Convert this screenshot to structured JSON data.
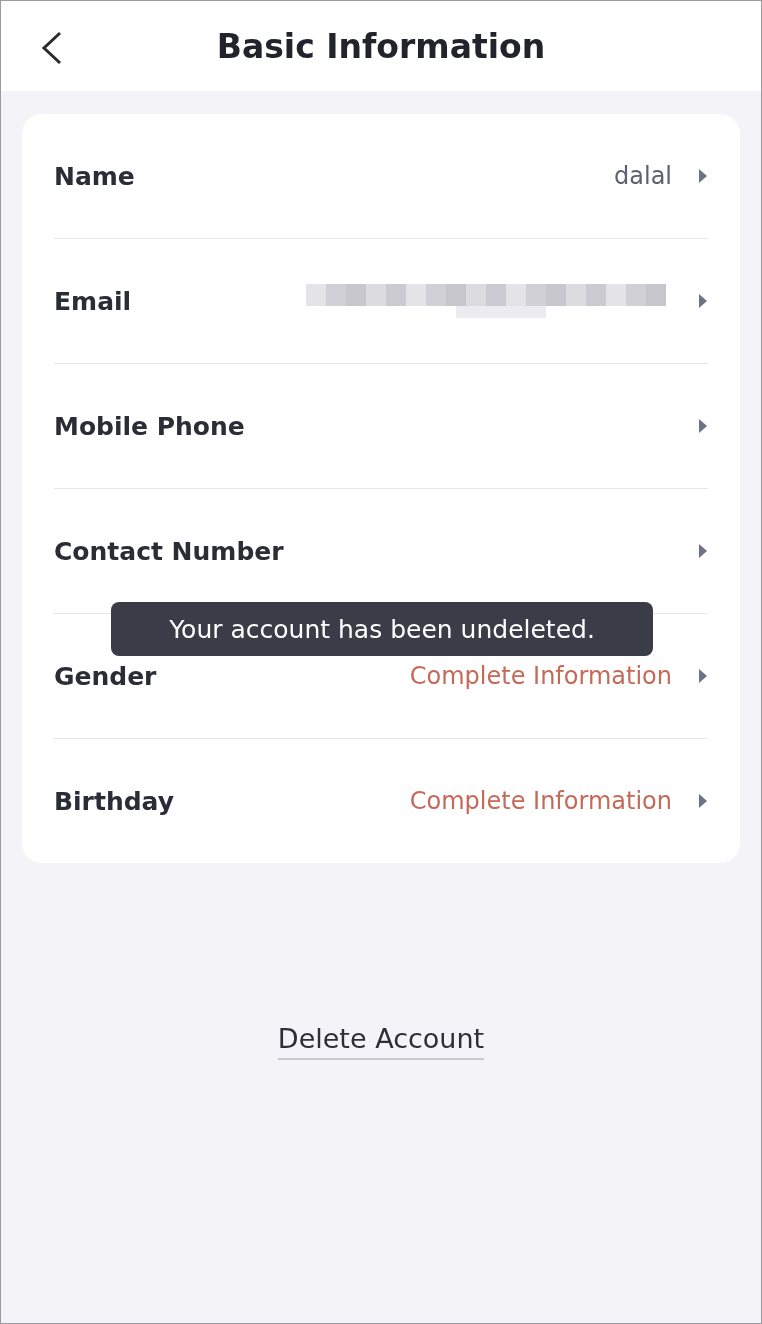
{
  "header": {
    "title": "Basic Information"
  },
  "rows": [
    {
      "label": "Name",
      "value": "dalal",
      "kind": "text"
    },
    {
      "label": "Email",
      "kind": "redacted"
    },
    {
      "label": "Mobile Phone",
      "kind": "empty"
    },
    {
      "label": "Contact Number",
      "kind": "empty"
    },
    {
      "label": "Gender",
      "value": "Complete Information",
      "kind": "prompt"
    },
    {
      "label": "Birthday",
      "value": "Complete Information",
      "kind": "prompt"
    }
  ],
  "delete_link": "Delete Account",
  "toast": {
    "message": "Your account has been undeleted."
  }
}
